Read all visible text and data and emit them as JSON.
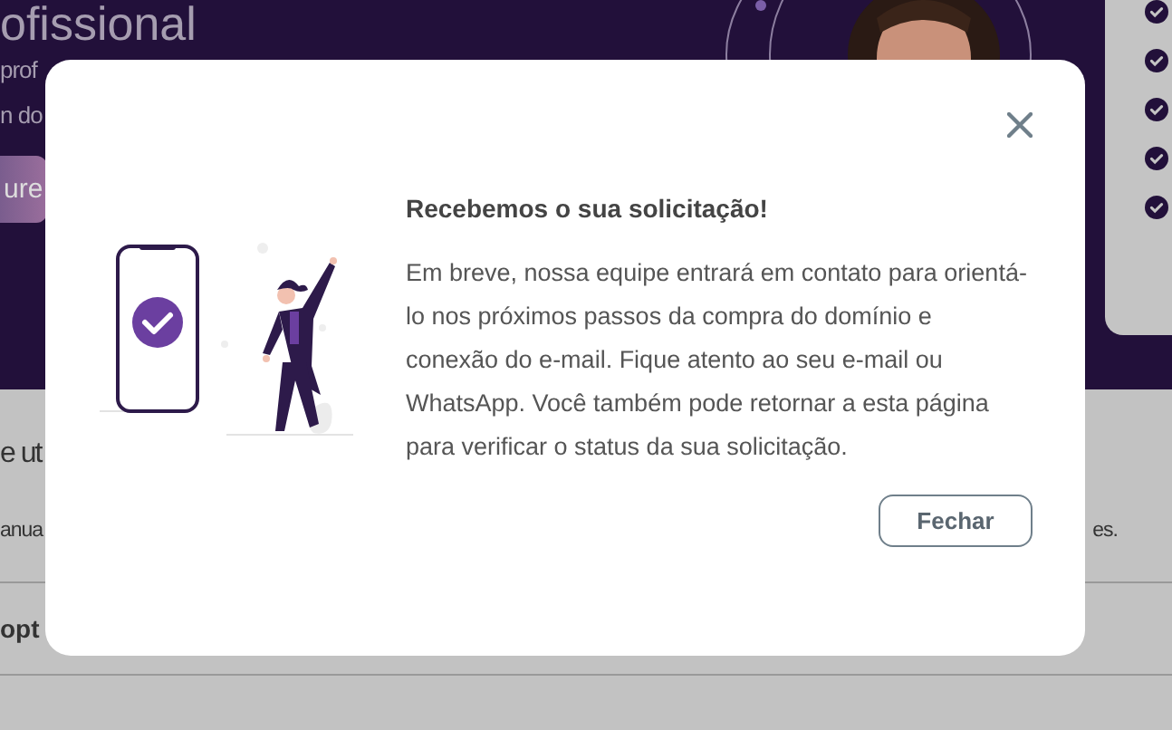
{
  "background": {
    "hero_title": "ofissional",
    "hero_lines": [
      "prof",
      "n do"
    ],
    "hero_button": "ure",
    "section_title": "e ut",
    "section_text_start": "anua",
    "section_text_end": "es.",
    "option_label": "opt"
  },
  "dialog": {
    "title": "Recebemos o sua solicitação!",
    "message": "Em breve, nossa equipe entrará em contato para orientá-lo nos próximos passos da compra do domínio e conexão do e-mail. Fique atento ao seu e-mail ou WhatsApp. Você também pode retornar a esta página para verificar o status da sua solicitação.",
    "button": "Fechar"
  }
}
